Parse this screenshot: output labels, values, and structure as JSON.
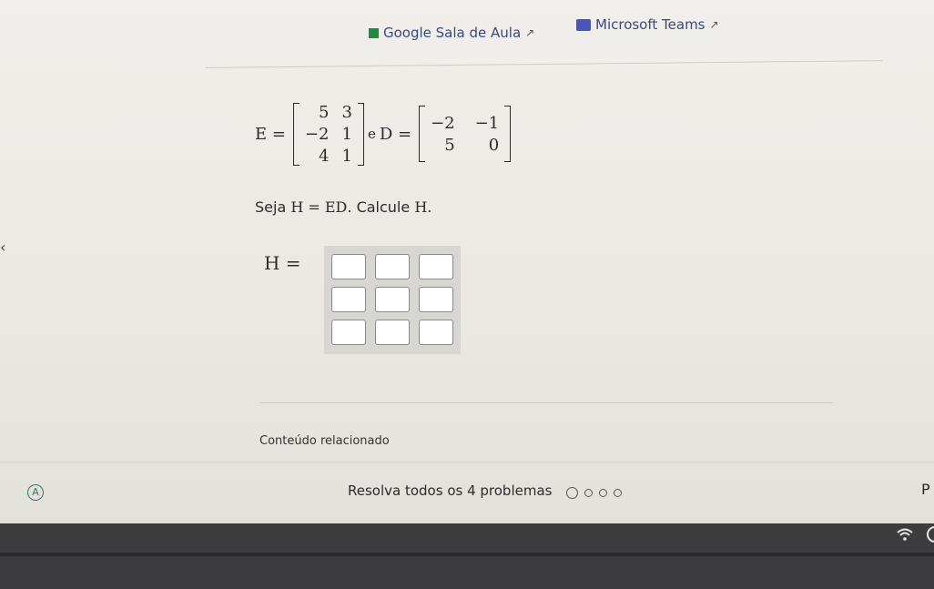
{
  "links": {
    "google_classroom": "Google Sala de Aula",
    "microsoft_teams": "Microsoft Teams",
    "external_glyph": "↗"
  },
  "problem": {
    "E_label": "E =",
    "E_matrix": [
      [
        "5",
        "3"
      ],
      [
        "−2",
        "1"
      ],
      [
        "4",
        "1"
      ]
    ],
    "conj": "e",
    "D_label": "D =",
    "D_matrix": [
      [
        "−2",
        "−1"
      ],
      [
        "5",
        "0"
      ]
    ],
    "question_prefix": "Seja",
    "question_math": "H = ED",
    "question_suffix": ". Calcule",
    "question_end": "H.",
    "answer_label": "H ="
  },
  "answer_cells": [
    [
      "",
      "",
      ""
    ],
    [
      "",
      "",
      ""
    ],
    [
      "",
      "",
      ""
    ]
  ],
  "related_title": "Conteúdo relacionado",
  "footer": {
    "badge": "A",
    "status": "Resolva todos os 4 problemas",
    "edge_char": "P"
  },
  "icons": {
    "classroom": "classroom-icon",
    "teams": "teams-icon",
    "wifi": "wifi-icon"
  }
}
